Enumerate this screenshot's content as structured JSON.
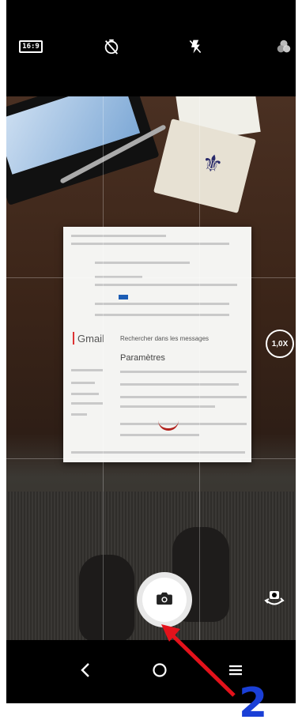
{
  "top_bar": {
    "aspect_ratio_label": "16:9",
    "icons": [
      "aspect-ratio-icon",
      "timer-off-icon",
      "flash-off-icon",
      "filters-icon"
    ]
  },
  "viewfinder": {
    "zoom_label": "1,0X",
    "document": {
      "app_name": "Gmail",
      "search_text": "Rechercher dans les messages",
      "section_title": "Paramètres"
    }
  },
  "controls": {
    "shutter_icon": "camera-icon",
    "switch_camera_icon": "switch-camera-icon"
  },
  "navbar": {
    "back_icon": "back-icon",
    "home_icon": "home-icon",
    "recents_icon": "recents-icon"
  },
  "annotation": {
    "step_number": "2",
    "arrow_color": "#e3121b",
    "number_color": "#1a3fd6"
  }
}
